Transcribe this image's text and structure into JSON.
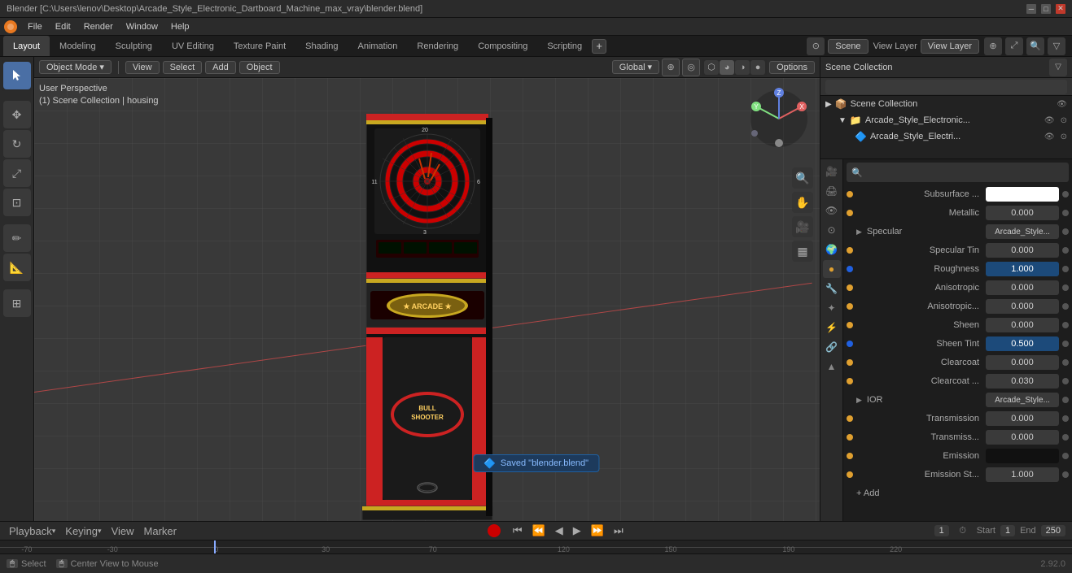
{
  "titleBar": {
    "title": "Blender [C:\\Users\\lenov\\Desktop\\Arcade_Style_Electronic_Dartboard_Machine_max_vray\\blender.blend]",
    "minBtn": "─",
    "maxBtn": "□",
    "closeBtn": "✕"
  },
  "menuBar": {
    "items": [
      "Blender",
      "File",
      "Edit",
      "Render",
      "Window",
      "Help"
    ]
  },
  "workspaceTabs": {
    "tabs": [
      "Layout",
      "Modeling",
      "Sculpting",
      "UV Editing",
      "Texture Paint",
      "Shading",
      "Animation",
      "Rendering",
      "Compositing",
      "Scripting"
    ],
    "activeTab": "Layout",
    "plusLabel": "+",
    "sceneName": "Scene",
    "viewLayerLabel": "View Layer",
    "viewLayerValue": "View Layer"
  },
  "viewport": {
    "perspectiveLabel": "User Perspective",
    "collectionLabel": "(1) Scene Collection | housing",
    "modeLabel": "Object Mode",
    "viewLabel": "View",
    "selectLabel": "Select",
    "addLabel": "Add",
    "objectLabel": "Object",
    "globalLabel": "Global",
    "optionsLabel": "Options"
  },
  "outliner": {
    "header": "Scene Collection",
    "items": [
      {
        "label": "Arcade_Style_Electronic...",
        "indent": 1,
        "hasEye": true
      },
      {
        "label": "Arcade_Style_Electri...",
        "indent": 2,
        "hasEye": true
      }
    ]
  },
  "properties": {
    "searchPlaceholder": "",
    "rows": [
      {
        "label": "Subsurface ...",
        "value": "",
        "type": "color-white",
        "hasDot": true,
        "dotType": "yellow"
      },
      {
        "label": "Metallic",
        "value": "0.000",
        "type": "normal",
        "hasDot": true,
        "dotType": "yellow"
      },
      {
        "label": "▶ Specular",
        "value": "Arcade_Style...",
        "type": "text",
        "hasDot": false,
        "isHeader": true
      },
      {
        "label": "Specular Tin",
        "value": "0.000",
        "type": "normal",
        "hasDot": true,
        "dotType": "yellow"
      },
      {
        "label": "Roughness",
        "value": "1.000",
        "type": "highlighted",
        "hasDot": true,
        "dotType": "blue"
      },
      {
        "label": "Anisotropic",
        "value": "0.000",
        "type": "normal",
        "hasDot": true,
        "dotType": "yellow"
      },
      {
        "label": "Anisotropic...",
        "value": "0.000",
        "type": "normal",
        "hasDot": true,
        "dotType": "yellow"
      },
      {
        "label": "Sheen",
        "value": "0.000",
        "type": "normal",
        "hasDot": true,
        "dotType": "yellow"
      },
      {
        "label": "Sheen Tint",
        "value": "0.500",
        "type": "highlighted",
        "hasDot": true,
        "dotType": "blue"
      },
      {
        "label": "Clearcoat",
        "value": "0.000",
        "type": "normal",
        "hasDot": true,
        "dotType": "yellow"
      },
      {
        "label": "Clearcoat ...",
        "value": "0.030",
        "type": "normal",
        "hasDot": true,
        "dotType": "yellow"
      },
      {
        "label": "▶ IOR",
        "value": "Arcade_Style...",
        "type": "text",
        "hasDot": false,
        "isHeader": true
      },
      {
        "label": "Transmission",
        "value": "0.000",
        "type": "normal",
        "hasDot": true,
        "dotType": "yellow"
      },
      {
        "label": "Transmiss...",
        "value": "0.000",
        "type": "normal",
        "hasDot": true,
        "dotType": "yellow"
      },
      {
        "label": "Emission",
        "value": "",
        "type": "black",
        "hasDot": true,
        "dotType": "yellow"
      },
      {
        "label": "Emission St...",
        "value": "1.000",
        "type": "normal",
        "hasDot": true,
        "dotType": "yellow"
      }
    ]
  },
  "timeline": {
    "playbackLabel": "Playback",
    "keyingLabel": "Keying",
    "viewLabel": "View",
    "markerLabel": "Marker",
    "currentFrame": "1",
    "startFrame": "1",
    "endFrame": "250",
    "startLabel": "Start",
    "endLabel": "End",
    "ticks": [
      "-70",
      "-30",
      "0",
      "30",
      "70",
      "120",
      "150",
      "190",
      "220"
    ]
  },
  "statusBar": {
    "selectKey": "Select",
    "centerKey": "Center View to Mouse",
    "savedMsg": "Saved \"blender.blend\"",
    "version": "2.92.0"
  },
  "icons": {
    "blender": "🟠",
    "cursor": "⊕",
    "move": "✥",
    "rotate": "↻",
    "scale": "⤢",
    "transform": "⊡",
    "annotate": "✏",
    "measure": "📐",
    "addObj": "⊞",
    "search": "🔍",
    "pan": "✋",
    "camera": "🎥",
    "grid": "▦",
    "eye": "👁",
    "triangle": "▶",
    "gear": "⚙",
    "shield": "🛡",
    "sphere": "○",
    "cube": "▪",
    "armature": "🦴",
    "constraint": "🔗",
    "particle": "✦",
    "physics": "⚡",
    "material": "●"
  }
}
